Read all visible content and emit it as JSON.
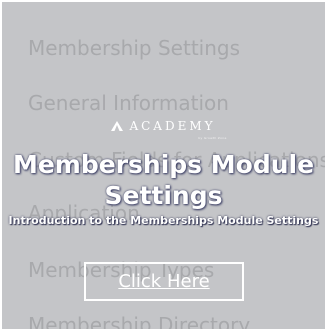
{
  "background_items": [
    "Membership Settings",
    "General Information",
    "Custom Fields for Applications",
    "Application",
    "Membership Types",
    "Membership Directory"
  ],
  "logo": {
    "word": "ACADEMY",
    "subtext": "by Growth Zone"
  },
  "title": "Memberships Module Settings",
  "subtitle": "Introduction to the Memberships Module Settings",
  "cta_label": "Click Here",
  "colors": {
    "overlay": "#c4c5c8",
    "text_shadow": "#3a3d63",
    "text": "#ffffff"
  }
}
